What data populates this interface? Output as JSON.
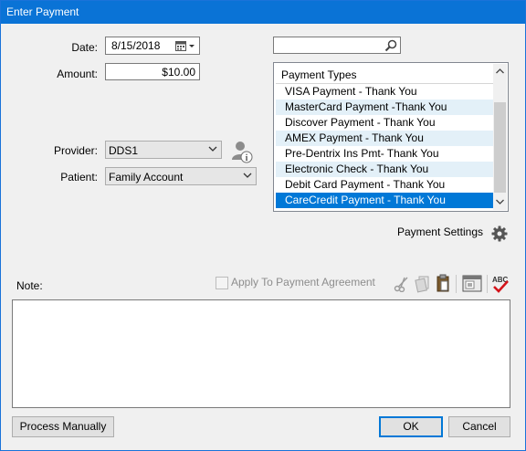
{
  "window": {
    "title": "Enter Payment"
  },
  "date": {
    "label": "Date:",
    "value": "8/15/2018"
  },
  "amount": {
    "label": "Amount:",
    "value": "$10.00"
  },
  "search": {
    "value": "",
    "icon": "search-icon"
  },
  "payment_types": {
    "header": "Payment Types",
    "items": [
      "VISA Payment - Thank You",
      "MasterCard Payment -Thank You",
      "Discover Payment - Thank You",
      "AMEX Payment - Thank You",
      "Pre-Dentrix Ins Pmt- Thank You",
      "Electronic Check - Thank You",
      "Debit Card Payment - Thank You",
      "CareCredit Payment - Thank You"
    ],
    "selected": "CareCredit Payment - Thank You"
  },
  "provider": {
    "label": "Provider:",
    "value": "DDS1"
  },
  "patient": {
    "label": "Patient:",
    "value": "Family Account"
  },
  "payment_settings": {
    "label": "Payment Settings"
  },
  "note": {
    "label": "Note:",
    "value": ""
  },
  "apply_agreement": {
    "label": "Apply To Payment Agreement",
    "checked": false
  },
  "buttons": {
    "process_manually": "Process Manually",
    "ok": "OK",
    "cancel": "Cancel"
  },
  "colors": {
    "title_bar": "#0a73d6",
    "selection": "#0078d7",
    "alt_row": "#e3f0f8"
  }
}
